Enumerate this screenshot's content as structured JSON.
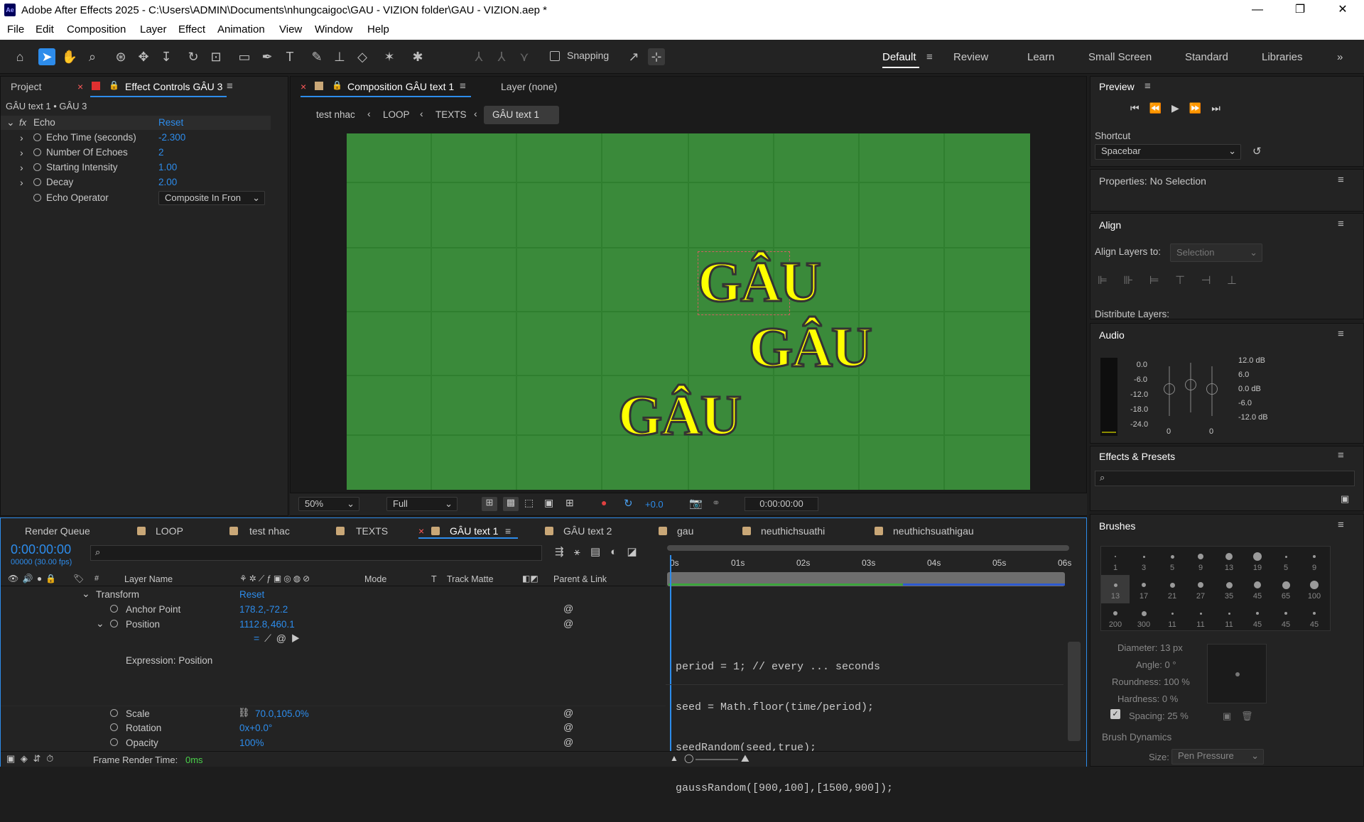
{
  "window": {
    "app_icon": "Ae",
    "title": "Adobe After Effects 2025 - C:\\Users\\ADMIN\\Documents\\nhungcaigoc\\GAU - VIZION folder\\GAU - VIZION.aep *"
  },
  "menu": [
    "File",
    "Edit",
    "Composition",
    "Layer",
    "Effect",
    "Animation",
    "View",
    "Window",
    "Help"
  ],
  "toolbar": {
    "snapping": "Snapping"
  },
  "workspaces": [
    "Default",
    "Review",
    "Learn",
    "Small Screen",
    "Standard",
    "Libraries"
  ],
  "left_panel": {
    "tab_project": "Project",
    "tab_effect": "Effect Controls GÂU 3",
    "subtitle": "GÂU text 1 • GÂU 3",
    "effect_name": "Echo",
    "reset": "Reset",
    "props": [
      {
        "name": "Echo Time (seconds)",
        "value": "-2.300"
      },
      {
        "name": "Number Of Echoes",
        "value": "2"
      },
      {
        "name": "Starting Intensity",
        "value": "1.00"
      },
      {
        "name": "Decay",
        "value": "2.00"
      },
      {
        "name": "Echo Operator",
        "value": "Composite In Fron"
      }
    ]
  },
  "comp_panel": {
    "tab_comp": "Composition GÂU text 1",
    "tab_layer": "Layer (none)",
    "breadcrumbs": [
      "test nhac",
      "LOOP",
      "TEXTS",
      "GÂU text 1"
    ],
    "gau_text": "GÂU",
    "zoom": "50%",
    "resolution": "Full",
    "exposure": "+0.0",
    "timecode": "0:00:00:00"
  },
  "right_panel": {
    "preview": "Preview",
    "shortcut_label": "Shortcut",
    "shortcut_value": "Spacebar",
    "properties": "Properties: No Selection",
    "align": "Align",
    "align_to_label": "Align Layers to:",
    "align_to_value": "Selection",
    "distribute": "Distribute Layers:",
    "audio": "Audio",
    "audio_left": [
      "0.0",
      "-6.0",
      "-12.0",
      "-18.0",
      "-24.0"
    ],
    "audio_right": [
      "12.0 dB",
      "6.0",
      "0.0 dB",
      "-6.0",
      "-12.0 dB"
    ],
    "audio_zero": "0",
    "effects_presets": "Effects & Presets",
    "brushes": "Brushes",
    "brush_sizes": [
      "1",
      "3",
      "5",
      "9",
      "13",
      "19",
      "5",
      "9",
      "13",
      "17",
      "21",
      "27",
      "35",
      "45",
      "65",
      "100",
      "200",
      "300",
      "11",
      "11",
      "11",
      "45",
      "45",
      "45"
    ],
    "diameter": "Diameter: 13 px",
    "angle": "Angle: 0 °",
    "roundness": "Roundness: 100 %",
    "hardness": "Hardness: 0 %",
    "spacing": "Spacing: 25 %",
    "dynamics": "Brush Dynamics",
    "size_label": "Size:",
    "size_value": "Pen Pressure"
  },
  "timeline": {
    "tabs": [
      "Render Queue",
      "LOOP",
      "test nhac",
      "TEXTS",
      "GÂU text 1",
      "GÂU text 2",
      "gau",
      "neuthichsuathi",
      "neuthichsuathigau"
    ],
    "timecode": "0:00:00:00",
    "fps": "00000 (30.00 fps)",
    "columns": {
      "layer_name": "Layer Name",
      "mode": "Mode",
      "t": "T",
      "track_matte": "Track Matte",
      "parent": "Parent & Link"
    },
    "ruler": [
      "0s",
      "01s",
      "02s",
      "03s",
      "04s",
      "05s",
      "06s"
    ],
    "transform": "Transform",
    "reset": "Reset",
    "anchor": {
      "name": "Anchor Point",
      "value": "178.2,-72.2"
    },
    "position": {
      "name": "Position",
      "x": "1112.8",
      "y": "460.1"
    },
    "expr_label": "Expression: Position",
    "scale": {
      "name": "Scale",
      "value": "70.0,105.0%"
    },
    "rotation": {
      "name": "Rotation",
      "value": "0x+0.0°"
    },
    "opacity": {
      "name": "Opacity",
      "value": "100%"
    },
    "code": [
      "period = 1; // every ... seconds",
      "seed = Math.floor(time/period);",
      "seedRandom(seed,true);",
      "gaussRandom([900,100],[1500,900]);"
    ],
    "render_label": "Frame Render Time:",
    "render_value": "0ms"
  }
}
